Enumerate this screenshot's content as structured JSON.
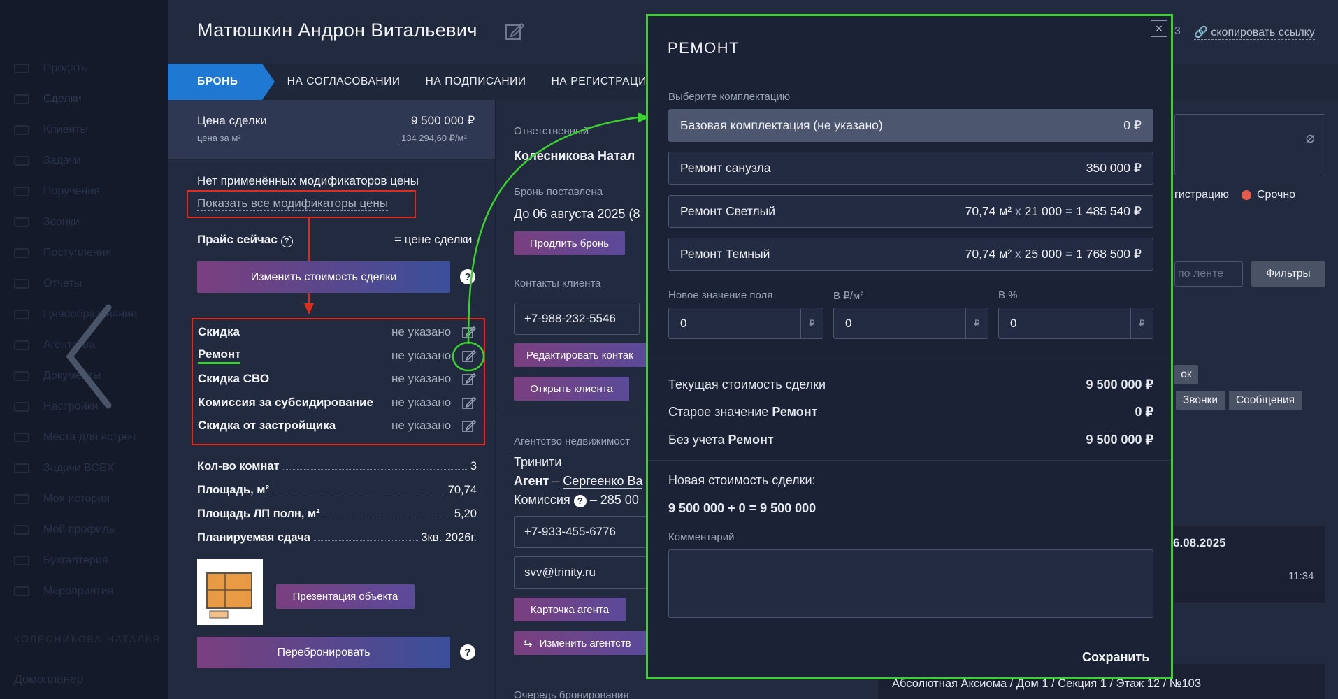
{
  "sidebar": {
    "items": [
      "Продать",
      "Сделки",
      "Клиенты",
      "Задачи",
      "Поручения",
      "Звонки",
      "Поступления",
      "Отчеты",
      "Ценообразование",
      "Агентства",
      "Документы",
      "Настройки",
      "Места для встреч",
      "Задачи ВСЕХ",
      "Моя история",
      "Мой профиль",
      "Бухгалтерия",
      "Мероприятия"
    ],
    "user": "КОЛЕСНИКОВА НАТАЛЬЯ",
    "bottom": "Домопланер"
  },
  "header": {
    "title": "Матюшкин Андрон Витальевич",
    "copy_link": "скопировать ссылку"
  },
  "tabs": [
    "БРОНЬ",
    "НА СОГЛАСОВАНИИ",
    "НА ПОДПИСАНИИ",
    "НА РЕГИСТРАЦИИ"
  ],
  "price": {
    "label": "Цена сделки",
    "value": "9 500 000 ₽",
    "per_m2_label": "цена за м²",
    "per_m2_value": "134 294,60 ₽/м²"
  },
  "modifiers": {
    "none_text": "Нет применённых модификаторов цены",
    "show_all": "Показать все модификаторы цены",
    "price_now_label": "Прайс сейчас",
    "price_now_value": "= цене сделки",
    "change_button": "Изменить стоимость сделки",
    "items": [
      {
        "name": "Скидка",
        "value": "не указано"
      },
      {
        "name": "Ремонт",
        "value": "не указано"
      },
      {
        "name": "Скидка СВО",
        "value": "не указано"
      },
      {
        "name": "Комиссия за субсидирование",
        "value": "не указано"
      },
      {
        "name": "Скидка от застройщика",
        "value": "не указано"
      }
    ]
  },
  "specs": [
    {
      "k": "Кол-во комнат",
      "v": "3"
    },
    {
      "k": "Площадь, м²",
      "v": "70,74"
    },
    {
      "k": "Площадь ЛП полн, м²",
      "v": "5,20"
    },
    {
      "k": "Планируемая сдача",
      "v": "3кв. 2026г."
    }
  ],
  "presentation_button": "Презентация объекта",
  "rebook_button": "Перебронировать",
  "middle": {
    "responsible_label": "Ответственный",
    "responsible": "Колесникова Натал",
    "booked_label": "Бронь поставлена",
    "booked_until": "До 06 августа 2025 (8",
    "extend_button": "Продлить бронь",
    "contacts_label": "Контакты клиента",
    "client_phone": "+7-988-232-5546",
    "edit_contacts_button": "Редактировать контак",
    "open_client_button": "Открыть клиента",
    "agency_label": "Агентство недвижимост",
    "agency_name": "Тринити",
    "agent_prefix": "Агент",
    "agent_name": "Сергеенко Ва",
    "commission_label": "Комиссия",
    "commission_value": "– 285 00",
    "agent_phone": "+7-933-455-6776",
    "agent_email": "svv@trinity.ru",
    "agent_card_button": "Карточка агента",
    "change_agency_button": "Изменить агентств",
    "queue_label": "Очередь бронирования"
  },
  "right": {
    "registration_tag": "гистрацию",
    "urgent_tag": "Срочно",
    "feed_placeholder": "по ленте",
    "filters_button": "Фильтры",
    "tag_ok": "ок",
    "calls_button": "Звонки",
    "messages_button": "Сообщения",
    "date": "6.08.2025",
    "time": "11:34",
    "address": "Абсолютная Аксиома / Дом 1 / Секция 1 / Этаж 12 / №103",
    "tab_hint": "3"
  },
  "modal": {
    "title": "РЕМОНТ",
    "pick_label": "Выберите комплектацию",
    "options": [
      {
        "name": "Базовая комплектация (не указано)",
        "value": "0 ₽"
      },
      {
        "name": "Ремонт санузла",
        "value": "350 000 ₽"
      },
      {
        "name": "Ремонт Светлый",
        "area": "70,74 м²",
        "rate": "21 000",
        "total": "1 485 540 ₽"
      },
      {
        "name": "Ремонт Темный",
        "area": "70,74 м²",
        "rate": "25 000",
        "total": "1 768 500 ₽"
      }
    ],
    "inputs": [
      {
        "label": "Новое значение поля",
        "value": "0",
        "unit": "₽"
      },
      {
        "label": "В ₽/м²",
        "value": "0",
        "unit": "₽"
      },
      {
        "label": "В %",
        "value": "0",
        "unit": "₽"
      }
    ],
    "current_label": "Текущая стоимость сделки",
    "current_value": "9 500 000 ₽",
    "old_label": "Старое значение",
    "old_name": "Ремонт",
    "old_value": "0 ₽",
    "without_label": "Без учета",
    "without_name": "Ремонт",
    "without_value": "9 500 000 ₽",
    "new_label": "Новая стоимость сделки:",
    "new_formula": "9 500 000 + 0 = 9 500 000",
    "comment_label": "Комментарий",
    "save_button": "Сохранить"
  },
  "colors": {
    "accent": "#1f78d1",
    "highlight_red": "#e02a1a",
    "highlight_green": "#3bd22f",
    "urgent": "#e35a4d"
  }
}
